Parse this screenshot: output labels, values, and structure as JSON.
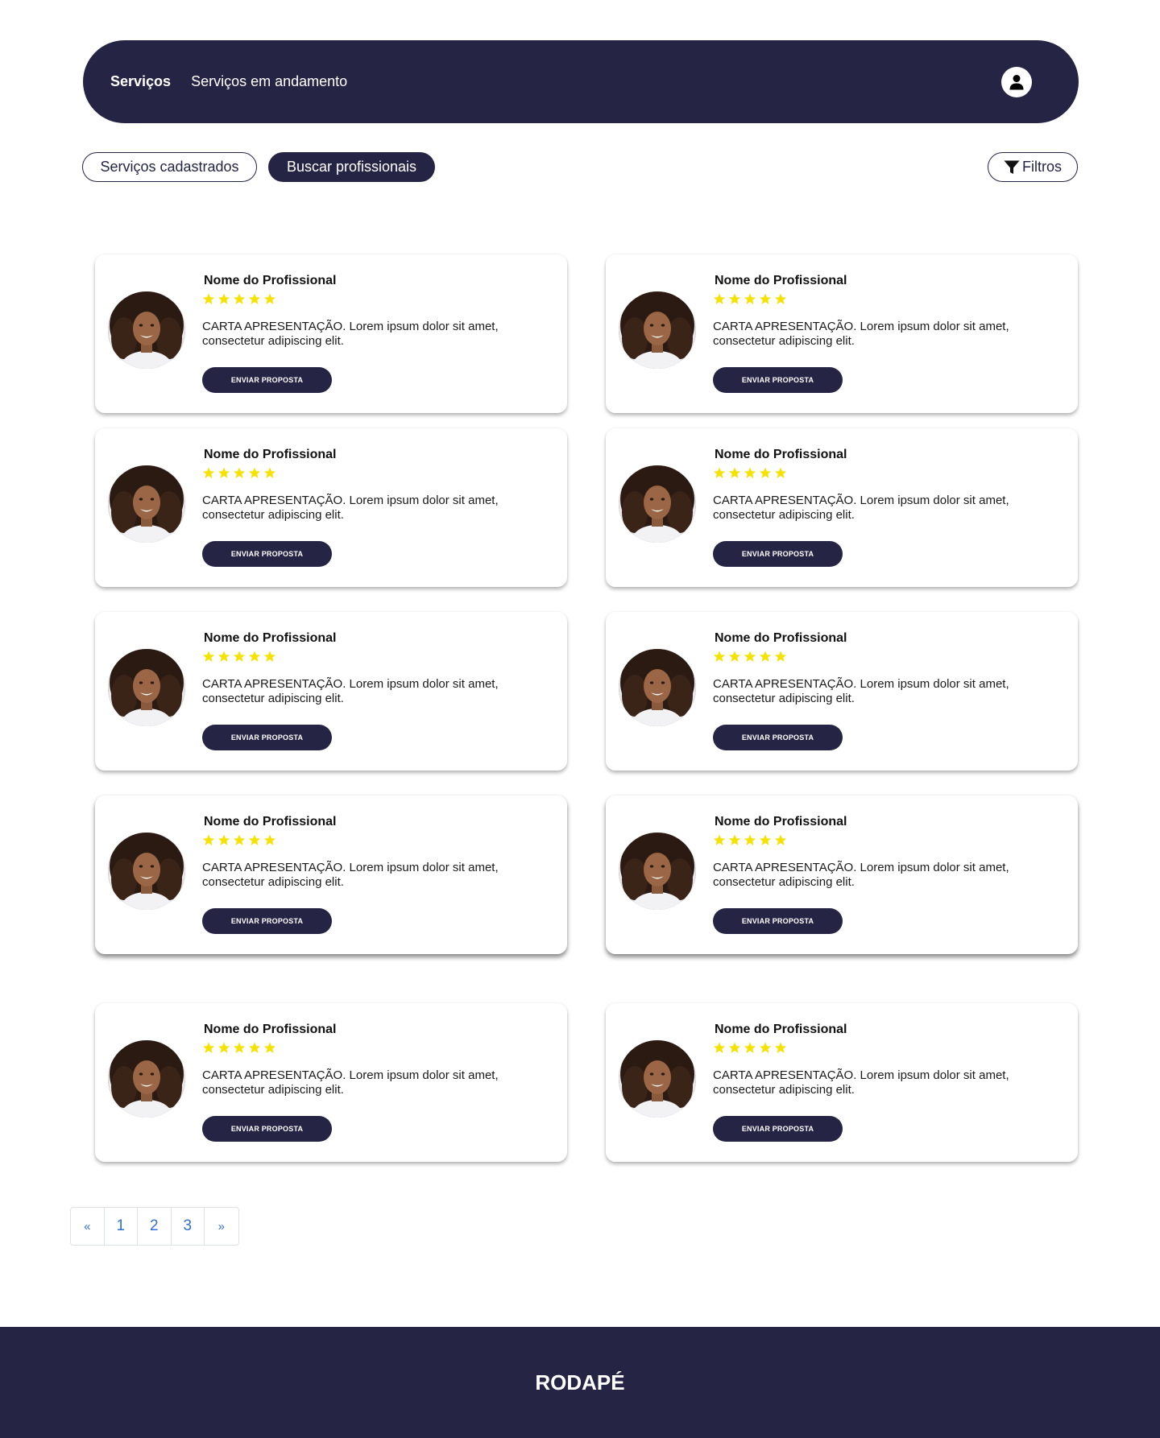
{
  "nav": {
    "links": [
      "Serviços",
      "Serviços em andamento"
    ],
    "profile_icon": "user-icon"
  },
  "toolbar": {
    "registered_label": "Serviços cadastrados",
    "search_label": "Buscar profissionais",
    "filters_label": "Filtros",
    "filters_icon": "filter-icon"
  },
  "card": {
    "name": "Nome do Profissional",
    "rating": 5,
    "max_rating": 5,
    "description": "CARTA APRESENTAÇÃO. Lorem ipsum dolor sit amet, consectetur adipiscing elit.",
    "button_label": "ENVIAR PROPOSTA",
    "star_color": "#f5e200"
  },
  "cards_count": 10,
  "pagination": {
    "prev": "«",
    "pages": [
      "1",
      "2",
      "3"
    ],
    "next": "»"
  },
  "footer": {
    "text": "RODAPÉ"
  },
  "colors": {
    "primary": "#262445",
    "link": "#2f6fd8"
  }
}
